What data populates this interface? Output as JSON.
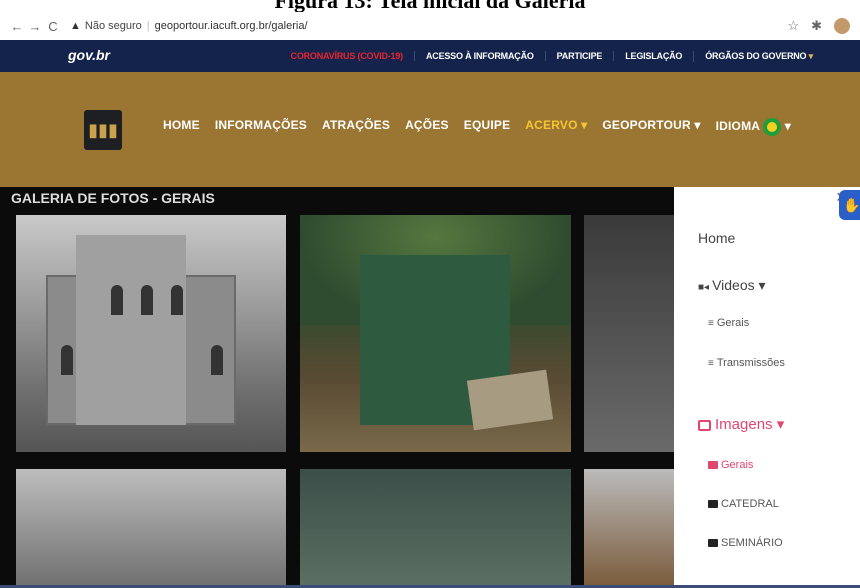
{
  "caption": "Figura 13: Tela inicial da Galeria",
  "browser": {
    "back": "←",
    "forward": "→",
    "reload": "C",
    "security": "Não seguro",
    "url": "geoportour.iacuft.org.br/galeria/",
    "star": "☆",
    "ext": "✱"
  },
  "govbar": {
    "logo": "gov.br",
    "links": [
      "CORONAVÍRUS (COVID-19)",
      "ACESSO À INFORMAÇÃO",
      "PARTICIPE",
      "LEGISLAÇÃO",
      "ÓRGÃOS DO GOVERNO"
    ],
    "chevron": "▾"
  },
  "nav": {
    "items": [
      "HOME",
      "INFORMAÇÕES",
      "ATRAÇÕES",
      "AÇÕES",
      "EQUIPE",
      "ACERVO ▾",
      "GEOPORTOUR ▾",
      "IDIOMA"
    ],
    "idioma_caret": "▾"
  },
  "gallery": {
    "title": "GALERIA DE FOTOS - GERAIS"
  },
  "sidebar": {
    "close": "×",
    "home": "Home",
    "videos": "Videos ▾",
    "videos_gerais": "Gerais",
    "transmissoes": "Transmissões",
    "imagens": "Imagens ▾",
    "imagens_gerais": "Gerais",
    "catedral": "CATEDRAL",
    "seminario": "SEMINÁRIO"
  },
  "colors": {
    "gov_bar": "#13234b",
    "nav_bg": "#9b7532",
    "active": "#f4c531",
    "covid": "#e8242e",
    "sidebar_active": "#e2466f"
  }
}
